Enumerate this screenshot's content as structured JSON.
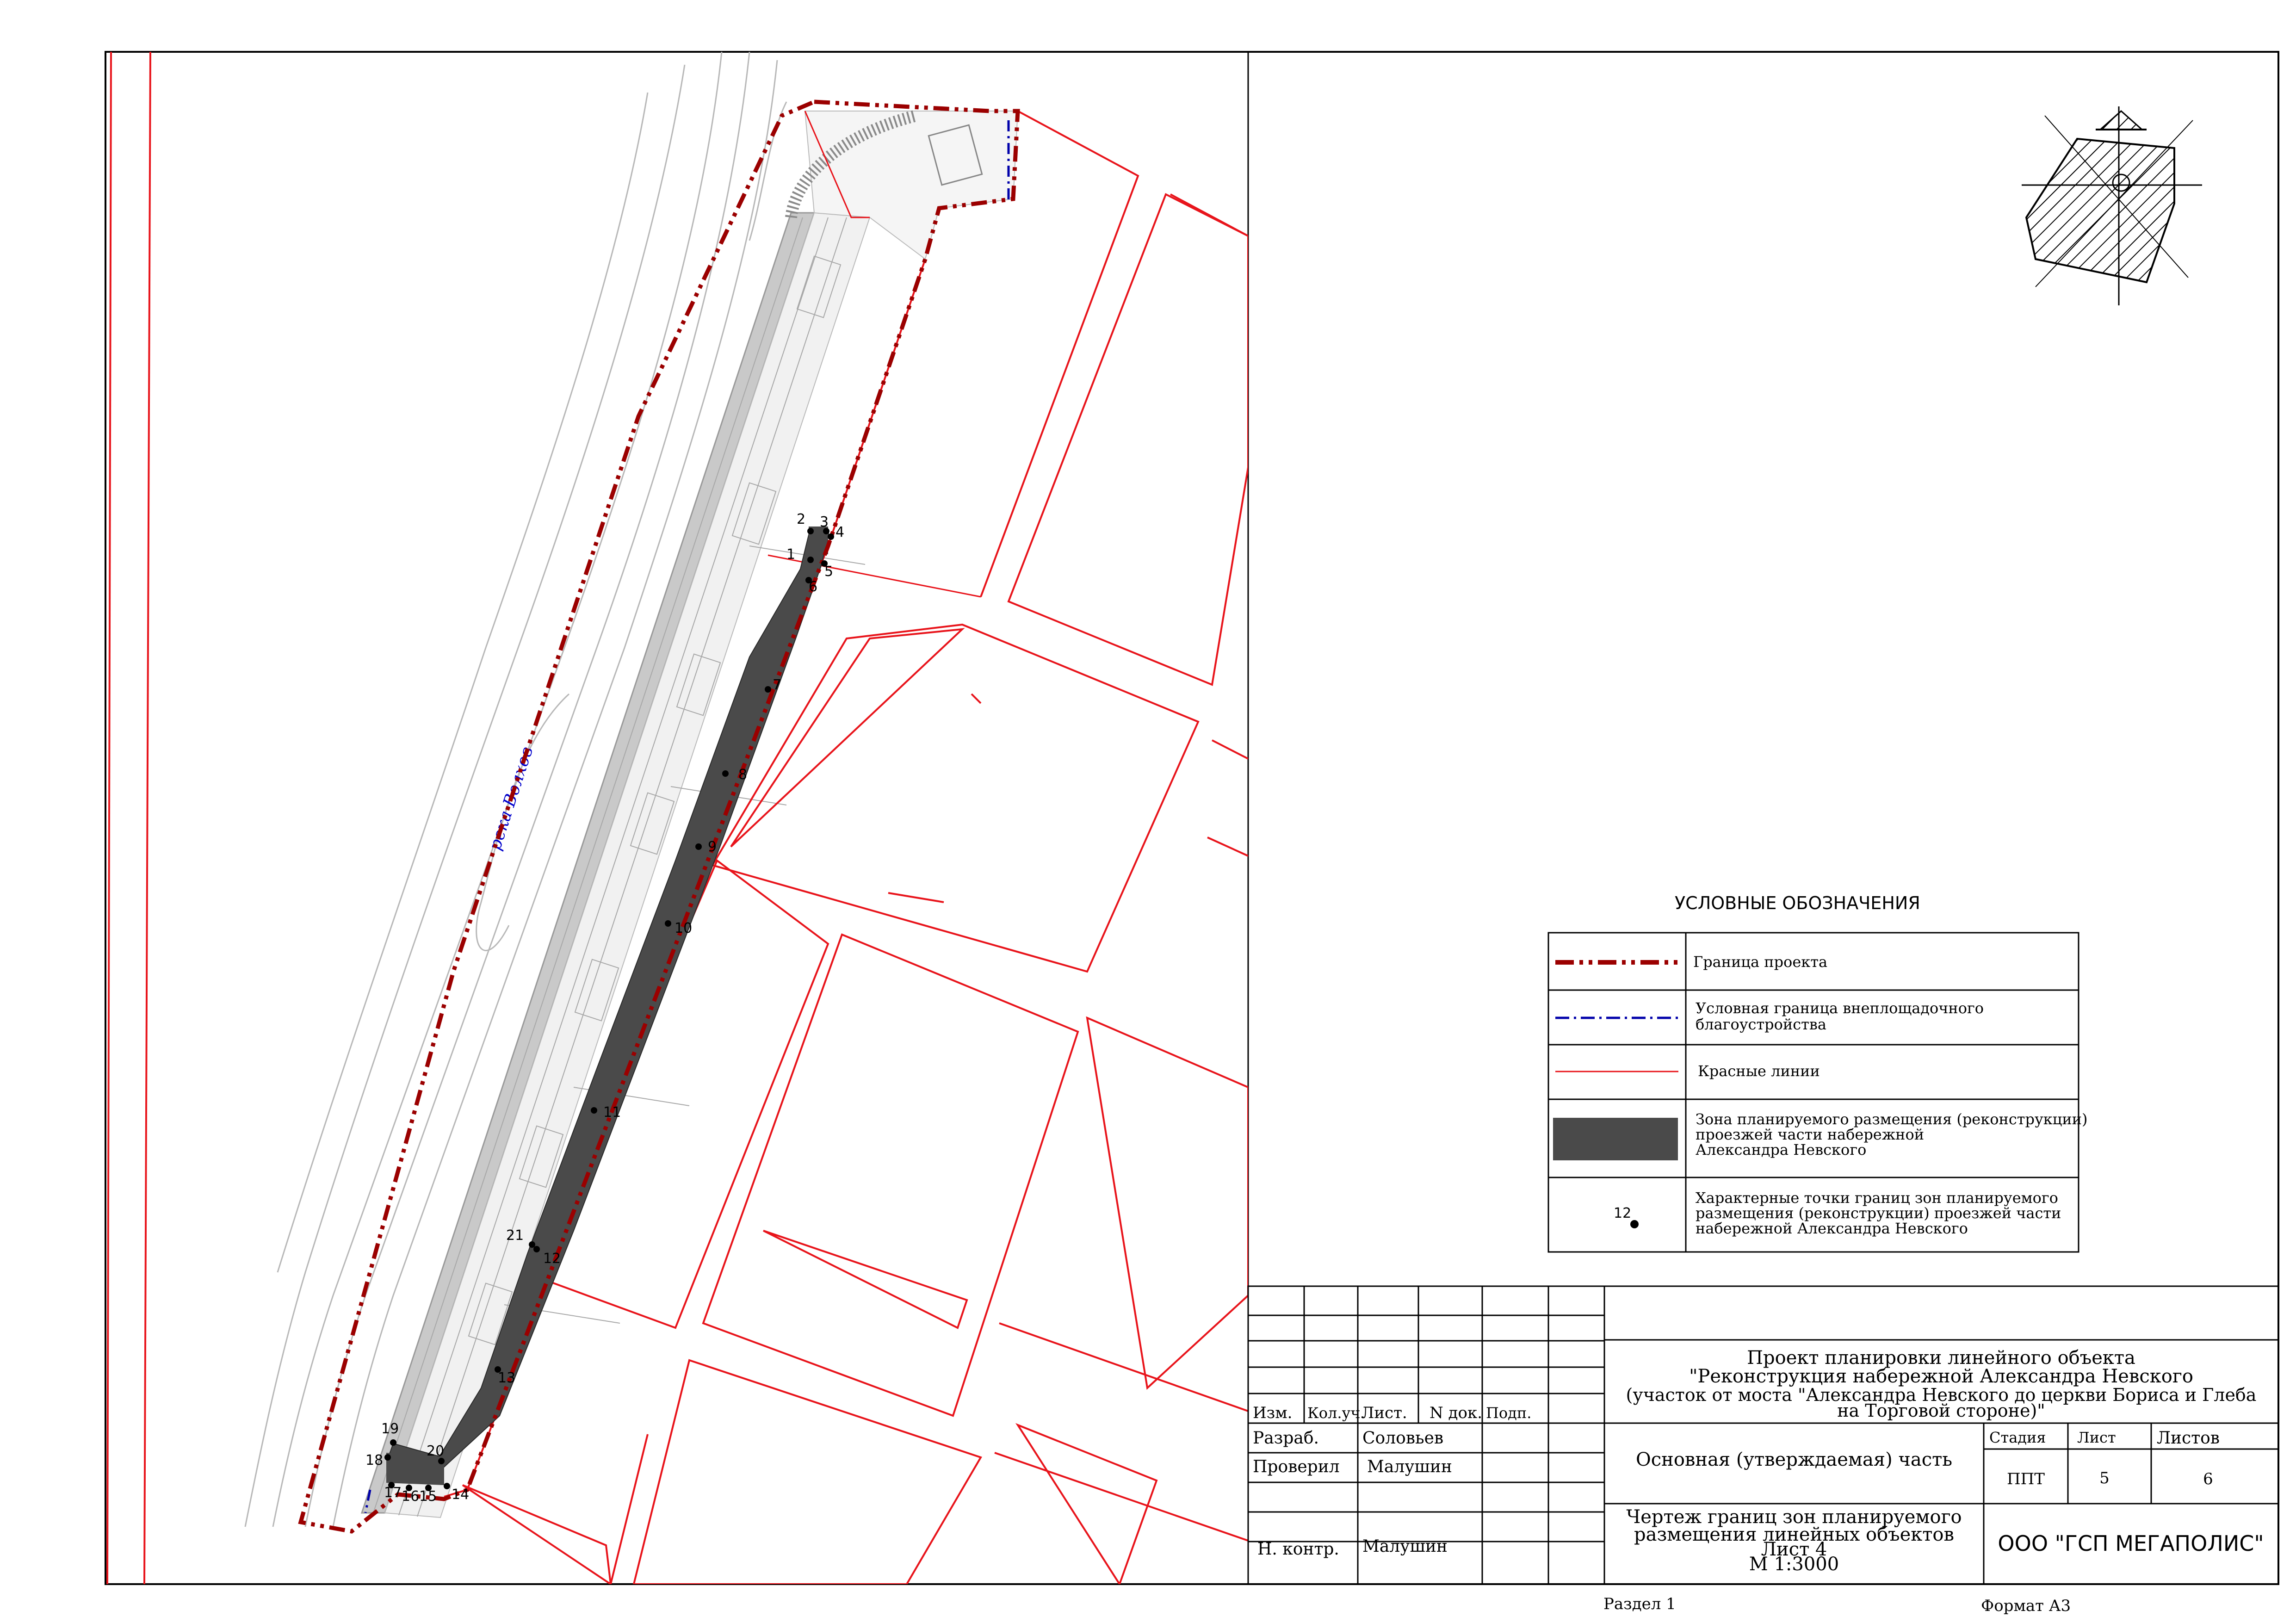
{
  "colors": {
    "project_boundary": "#9b0000",
    "offsite_boundary": "#0000aa",
    "red_lines": "#e8141b",
    "reconstruction_zone": "#4a4a4a",
    "topo_lines": "#b8b8b8"
  },
  "map": {
    "river_label": "река Волхов",
    "points": [
      "1",
      "2",
      "3",
      "4",
      "5",
      "6",
      "7",
      "8",
      "9",
      "10",
      "11",
      "12",
      "13",
      "14",
      "15",
      "16",
      "17",
      "18",
      "19",
      "20",
      "21"
    ]
  },
  "north_arrow": {
    "icon": "north-arrow-icon"
  },
  "legend": {
    "title": "УСЛОВНЫЕ ОБОЗНАЧЕНИЯ",
    "items": [
      {
        "label": "Граница проекта",
        "icon": "dash-dot-red-line-icon"
      },
      {
        "label": "Условная граница внеплощадочного благоустройства",
        "line1": "Условная граница внеплощадочного",
        "line2": "благоустройства",
        "icon": "dash-dot-blue-line-icon"
      },
      {
        "label": "Красные линии",
        "icon": "thin-red-line-icon"
      },
      {
        "label": "Зона планируемого размещения (реконструкции) проезжей части набережной Александра Невского",
        "line1": "Зона планируемого размещения (реконструкции)",
        "line2": "проезжей части набережной",
        "line3": "Александра Невского",
        "icon": "dark-fill-rect-icon"
      },
      {
        "label": "Характерные точки границ зон планируемого размещения (реконструкции) проезжей части набережной Александра Невского",
        "line1": "Характерные точки границ зон планируемого",
        "line2": "размещения (реконструкции) проезжей части",
        "line3": "набережной Александра Невского",
        "sample_number": "12",
        "icon": "point-marker-icon"
      }
    ]
  },
  "title_block": {
    "headers": [
      "Изм.",
      "Кол.уч.",
      "Лист.",
      "N док.",
      "Подп."
    ],
    "developed_label": "Разраб.",
    "developed_name": "Соловьев",
    "checked_label": "Проверил",
    "checked_name": "Малушин",
    "norm_control_label": "Н. контр.",
    "norm_control_name": "Малушин",
    "project_title_1": "Проект планировки линейного объекта",
    "project_title_2": "\"Реконструкция набережной Александра Невского",
    "project_title_3": "(участок от моста \"Александра Невского до церкви Бориса и Глеба",
    "project_title_4": "на Торговой стороне)\"",
    "part_label": "Основная (утверждаемая) часть",
    "stage_header": "Стадия",
    "sheet_header": "Лист",
    "sheets_header": "Листов",
    "stage_value": "ППТ",
    "sheet_value": "5",
    "sheets_value": "6",
    "drawing_title_1": "Чертеж границ зон планируемого",
    "drawing_title_2": "размещения линейных объектов",
    "drawing_title_3": "Лист 4",
    "drawing_title_4": "М 1:3000",
    "company": "ООО \"ГСП МЕГАПОЛИС\""
  },
  "footer": {
    "section": "Раздел 1",
    "format": "Формат А3"
  }
}
